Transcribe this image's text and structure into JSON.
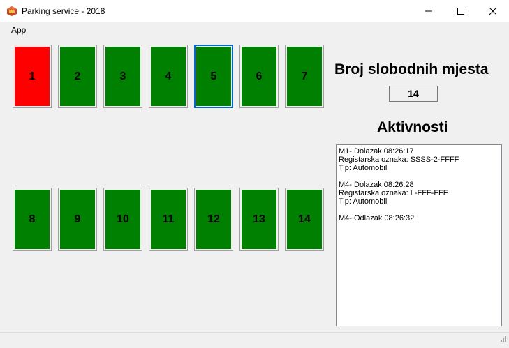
{
  "window": {
    "title": "Parking service - 2018",
    "icon": "parking-app-icon"
  },
  "menu": {
    "app_label": "App"
  },
  "spots": [
    {
      "label": "1",
      "status": "occupied",
      "color": "#ff0000"
    },
    {
      "label": "2",
      "status": "free",
      "color": "#008000"
    },
    {
      "label": "3",
      "status": "free",
      "color": "#008000"
    },
    {
      "label": "4",
      "status": "free",
      "color": "#008000"
    },
    {
      "label": "5",
      "status": "free",
      "color": "#008000",
      "focused": true
    },
    {
      "label": "6",
      "status": "free",
      "color": "#008000"
    },
    {
      "label": "7",
      "status": "free",
      "color": "#008000"
    },
    {
      "label": "8",
      "status": "free",
      "color": "#008000"
    },
    {
      "label": "9",
      "status": "free",
      "color": "#008000"
    },
    {
      "label": "10",
      "status": "free",
      "color": "#008000"
    },
    {
      "label": "11",
      "status": "free",
      "color": "#008000"
    },
    {
      "label": "12",
      "status": "free",
      "color": "#008000"
    },
    {
      "label": "13",
      "status": "free",
      "color": "#008000"
    },
    {
      "label": "14",
      "status": "free",
      "color": "#008000"
    }
  ],
  "free_spots": {
    "heading": "Broj slobodnih mjesta",
    "value": "14"
  },
  "activities": {
    "heading": "Aktivnosti",
    "entries": [
      [
        "M1- Dolazak 08:26:17",
        "Registarska oznaka: SSSS-2-FFFF",
        "Tip: Automobil"
      ],
      [
        "M4- Dolazak 08:26:28",
        "Registarska oznaka: L-FFF-FFF",
        "Tip: Automobil"
      ],
      [
        "M4- Odlazak 08:26:32"
      ]
    ]
  }
}
